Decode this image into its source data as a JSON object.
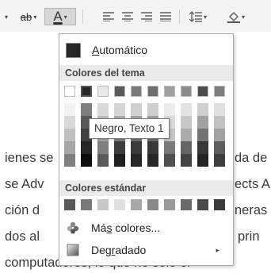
{
  "ribbon": {
    "font_color_glyph": "A",
    "highlight_glyph": "ab",
    "dropdown_glyph": "▾"
  },
  "document": {
    "lines": [
      "ienes se",
      "se Adv",
      "ción d",
      "dos al",
      "computadores, lo que no solo el"
    ],
    "lines_right": [
      "da de",
      "ects A",
      "neras",
      "prin"
    ]
  },
  "panel": {
    "automatic": {
      "label_u": "A",
      "label_rest": "utomático",
      "color": "#262626"
    },
    "theme_title": "Colores del tema",
    "theme_top": [
      "#ffffff",
      "#262626",
      "#e8e8e8",
      "#5a5a5a",
      "#7a7a7a",
      "#6e6e6e",
      "#a0a0a0",
      "#8c8c8c",
      "#4d4d4d",
      "#7e7e7e"
    ],
    "theme_shades": [
      [
        "#f2f2f2",
        "#7f7f7f",
        "#d9d9d9",
        "#d6d6d6",
        "#d0d0d0",
        "#cfcfcf",
        "#ececec",
        "#e3e3e3",
        "#d0d0d0",
        "#e0e0e0"
      ],
      [
        "#d9d9d9",
        "#595959",
        "#bfbfbf",
        "#adadad",
        "#a2a2a2",
        "#a0a0a0",
        "#d9d9d9",
        "#c8c8c8",
        "#a2a2a2",
        "#c1c1c1"
      ],
      [
        "#bfbfbf",
        "#404040",
        "#a6a6a6",
        "#838383",
        "#737373",
        "#717171",
        "#c6c6c6",
        "#acacac",
        "#737373",
        "#a2a2a2"
      ],
      [
        "#a6a6a6",
        "#262626",
        "#7f7f7f",
        "#3d3d3d",
        "#3a3a3a",
        "#383838",
        "#787878",
        "#656565",
        "#383838",
        "#5d5d5d"
      ],
      [
        "#7f7f7f",
        "#0d0d0d",
        "#595959",
        "#1f1f1f",
        "#262626",
        "#262626",
        "#505050",
        "#434343",
        "#262626",
        "#3e3e3e"
      ]
    ],
    "standard_title": "Colores estándar",
    "standard": [
      "#5a5a5a",
      "#7a7a7a",
      "#c8c8c8",
      "#e0e0e0",
      "#a8a8a8",
      "#8a8a8a",
      "#9a9a9a",
      "#6a6a6a",
      "#4a4a4a",
      "#3a3a3a"
    ],
    "more_colors": {
      "pre": "Má",
      "u": "s",
      "post": " colores..."
    },
    "gradient": {
      "pre": "Deg",
      "u": "r",
      "post": "adado",
      "arrow": "▸"
    }
  },
  "tooltip": {
    "text": "Negro, Texto 1"
  }
}
